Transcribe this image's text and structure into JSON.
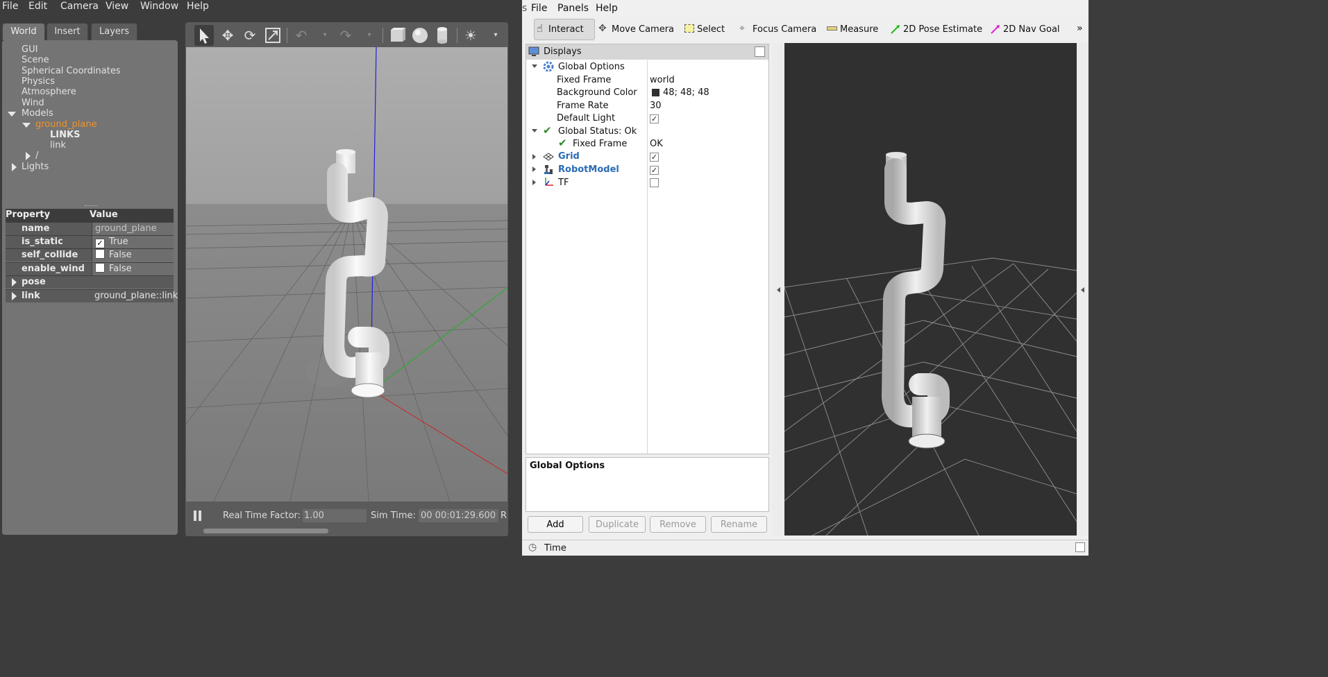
{
  "gazebo": {
    "menu": [
      "File",
      "Edit",
      "Camera",
      "View",
      "Window",
      "Help"
    ],
    "tabs": [
      "World",
      "Insert",
      "Layers"
    ],
    "tree": {
      "items": [
        "GUI",
        "Scene",
        "Spherical Coordinates",
        "Physics",
        "Atmosphere",
        "Wind"
      ],
      "models_label": "Models",
      "model_name": "ground_plane",
      "links_header": "LINKS",
      "link_item": "link",
      "slash_item": "/",
      "lights_label": "Lights"
    },
    "properties": {
      "header_property": "Property",
      "header_value": "Value",
      "rows": [
        {
          "key": "name",
          "value": "ground_plane"
        },
        {
          "key": "is_static",
          "value": "True",
          "checked": true
        },
        {
          "key": "self_collide",
          "value": "False",
          "checked": false
        },
        {
          "key": "enable_wind",
          "value": "False",
          "checked": false
        },
        {
          "key": "pose",
          "value": ""
        },
        {
          "key": "link",
          "value": "ground_plane::link"
        }
      ]
    },
    "bottom": {
      "rtf_label": "Real Time Factor:",
      "rtf_value": "1.00",
      "sim_time_label": "Sim Time:",
      "sim_time_value": "00 00:01:29.600",
      "trailing": "R"
    }
  },
  "rviz": {
    "menu": [
      "File",
      "Panels",
      "Help"
    ],
    "left_edge_char": "s",
    "tools": [
      "Interact",
      "Move Camera",
      "Select",
      "Focus Camera",
      "Measure",
      "2D Pose Estimate",
      "2D Nav Goal"
    ],
    "overflow": "»",
    "displays": {
      "title": "Displays",
      "global_options": "Global Options",
      "fixed_frame_label": "Fixed Frame",
      "fixed_frame_value": "world",
      "bg_color_label": "Background Color",
      "bg_color_value": "48; 48; 48",
      "bg_color_swatch": "#303030",
      "frame_rate_label": "Frame Rate",
      "frame_rate_value": "30",
      "default_light_label": "Default Light",
      "global_status": "Global Status: Ok",
      "status_fixed_frame": "Fixed Frame",
      "status_fixed_frame_value": "OK",
      "grid": "Grid",
      "robot_model": "RobotModel",
      "tf": "TF"
    },
    "description_title": "Global Options",
    "buttons": [
      "Add",
      "Duplicate",
      "Remove",
      "Rename"
    ],
    "time_label": "Time",
    "accent": "#2a6bb5"
  }
}
